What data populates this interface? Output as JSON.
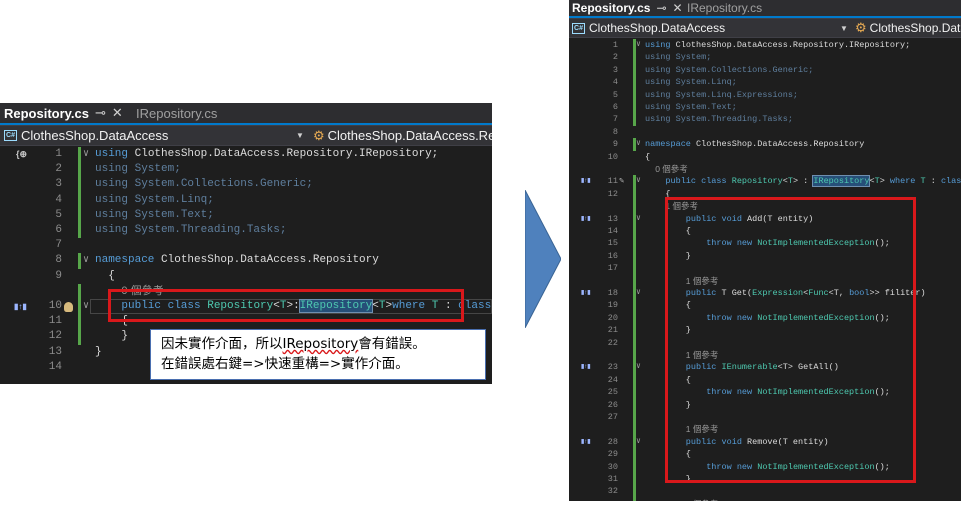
{
  "colors": {
    "editor_bg": "#1e1e1e",
    "keyword": "#569cd6",
    "type": "#4ec9b0",
    "selection": "#264f78",
    "highlight_box": "#d9181b",
    "arrow": "#4f81bd"
  },
  "left": {
    "tabs": {
      "active": "Repository.cs",
      "inactive": "IRepository.cs"
    },
    "nav": {
      "project": "ClothesShop.DataAccess",
      "member": "ClothesShop.DataAccess.Re"
    },
    "lines": [
      {
        "n": "1",
        "t": "using ClothesShop.DataAccess.Repository.IRepository;"
      },
      {
        "n": "2",
        "t": "using System;"
      },
      {
        "n": "3",
        "t": "using System.Collections.Generic;"
      },
      {
        "n": "4",
        "t": "using System.Linq;"
      },
      {
        "n": "5",
        "t": "using System.Text;"
      },
      {
        "n": "6",
        "t": "using System.Threading.Tasks;"
      },
      {
        "n": "7",
        "t": ""
      },
      {
        "n": "8",
        "t": "namespace ClothesShop.DataAccess.Repository"
      },
      {
        "n": "9",
        "t": "{"
      },
      {
        "n": "",
        "t": "0 個參考"
      },
      {
        "n": "10",
        "t": "public class Repository<T>:IRepository<T>where T : class"
      },
      {
        "n": "11",
        "t": "{"
      },
      {
        "n": "12",
        "t": "}"
      },
      {
        "n": "13",
        "t": "}"
      },
      {
        "n": "14",
        "t": ""
      }
    ],
    "callout": {
      "line1_a": "因未實作介面，所以",
      "line1_b": "IRepository",
      "line1_c": "會有錯誤。",
      "line2": "在錯誤處右鍵=>快速重構=>實作介面。"
    }
  },
  "right": {
    "tabs": {
      "active": "Repository.cs",
      "inactive": "IRepository.cs"
    },
    "nav": {
      "project": "ClothesShop.DataAccess",
      "member": "ClothesShop.DataA"
    },
    "lines": [
      {
        "n": "1",
        "t": "using ClothesShop.DataAccess.Repository.IRepository;"
      },
      {
        "n": "2",
        "t": "using System;"
      },
      {
        "n": "3",
        "t": "using System.Collections.Generic;"
      },
      {
        "n": "4",
        "t": "using System.Linq;"
      },
      {
        "n": "5",
        "t": "using System.Linq.Expressions;"
      },
      {
        "n": "6",
        "t": "using System.Text;"
      },
      {
        "n": "7",
        "t": "using System.Threading.Tasks;"
      },
      {
        "n": "8",
        "t": ""
      },
      {
        "n": "9",
        "t": "namespace ClothesShop.DataAccess.Repository"
      },
      {
        "n": "10",
        "t": "{"
      },
      {
        "n": "",
        "t": "0 個參考"
      },
      {
        "n": "11",
        "t": "public class Repository<T> : IRepository<T> where T : class"
      },
      {
        "n": "12",
        "t": "{"
      },
      {
        "n": "",
        "t": "1 個參考"
      },
      {
        "n": "13",
        "t": "public void Add(T entity)"
      },
      {
        "n": "14",
        "t": "{"
      },
      {
        "n": "15",
        "t": "throw new NotImplementedException();"
      },
      {
        "n": "16",
        "t": "}"
      },
      {
        "n": "17",
        "t": ""
      },
      {
        "n": "",
        "t": "1 個參考"
      },
      {
        "n": "18",
        "t": "public T Get(Expression<Func<T, bool>> filiter)"
      },
      {
        "n": "19",
        "t": "{"
      },
      {
        "n": "20",
        "t": "throw new NotImplementedException();"
      },
      {
        "n": "21",
        "t": "}"
      },
      {
        "n": "22",
        "t": ""
      },
      {
        "n": "",
        "t": "1 個參考"
      },
      {
        "n": "23",
        "t": "public IEnumerable<T> GetAll()"
      },
      {
        "n": "24",
        "t": "{"
      },
      {
        "n": "25",
        "t": "throw new NotImplementedException();"
      },
      {
        "n": "26",
        "t": "}"
      },
      {
        "n": "27",
        "t": ""
      },
      {
        "n": "",
        "t": "1 個參考"
      },
      {
        "n": "28",
        "t": "public void Remove(T entity)"
      },
      {
        "n": "29",
        "t": "{"
      },
      {
        "n": "30",
        "t": "throw new NotImplementedException();"
      },
      {
        "n": "31",
        "t": "}"
      },
      {
        "n": "32",
        "t": ""
      },
      {
        "n": "",
        "t": "1 個參考"
      }
    ]
  }
}
